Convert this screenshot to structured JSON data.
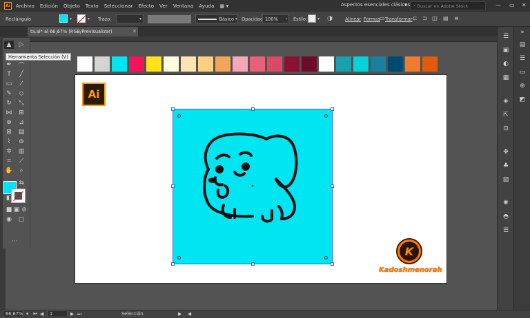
{
  "menu": {
    "logo": "Ai",
    "items": [
      "Archivo",
      "Edición",
      "Objeto",
      "Texto",
      "Seleccionar",
      "Efecto",
      "Ver",
      "Ventana",
      "Ayuda"
    ],
    "workspace": "Aspectos esenciales clásicos",
    "stock_placeholder": "Buscar en Adobe Stock"
  },
  "control": {
    "tool_label": "Rectángulo",
    "stroke_label": "Trazo:",
    "brush_label": "Básico",
    "opacity_label": "Opacidad:",
    "opacity_value": "100%",
    "style_label": "Estilo:",
    "align": "Alinear",
    "forms": "Formas",
    "transform": "Transformar"
  },
  "tab": {
    "title": "ta.ai* al 66,67% (RGB/Previsualizar)",
    "close": "×"
  },
  "tooltip": "Herramienta Selección (V)",
  "swatches": [
    "#ffffff",
    "#d4d4d4",
    "#00e5f2",
    "#f0145a",
    "#ffe21a",
    "#fffde0",
    "#ffe4b3",
    "#ffd080",
    "#f2a65a",
    "#f7a8b8",
    "#e8607a",
    "#d94a64",
    "#8c1032",
    "#6e0a2a",
    "#ffffff",
    "#1aa0b0",
    "#00d4d8",
    "#1a7fa0",
    "#004a70",
    "#f07a30",
    "#e05a10"
  ],
  "artboard": {
    "logo": "Ai",
    "brand_letter": "K",
    "brand_name": "Kadoshmenorah"
  },
  "colors": {
    "fill": "#00e5f2",
    "accent": "#ff7a00"
  },
  "status": {
    "zoom": "66,67%",
    "page": "1",
    "tool": "Selección"
  }
}
